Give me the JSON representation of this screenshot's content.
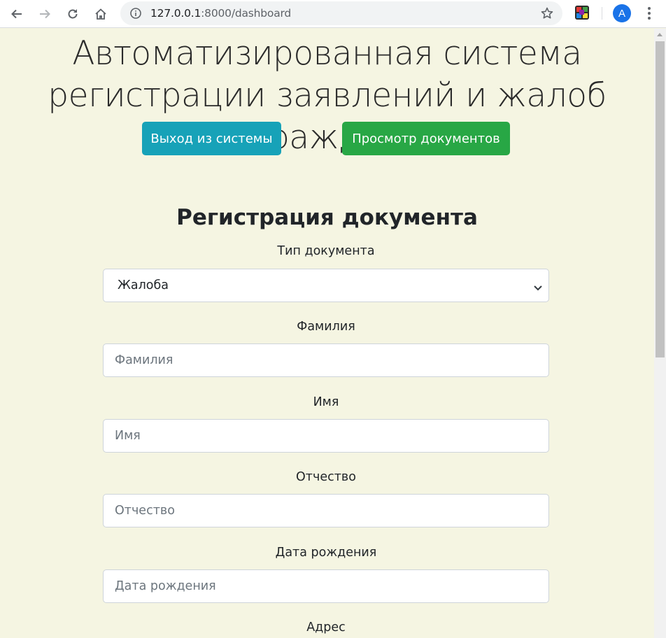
{
  "browser": {
    "url_host": "127.0.0.1",
    "url_rest": ":8000/dashboard",
    "profile_initial": "A",
    "accent_color": "#1a73e8"
  },
  "header": {
    "title_line1": "Автоматизированная система",
    "title_line2": "регистрации заявлений и жалоб граждан",
    "logout_label": "Выход из системы",
    "docs_label": "Просмотр документов",
    "logout_color": "#17a2b8",
    "docs_color": "#28a745"
  },
  "form": {
    "title": "Регистрация документа",
    "doc_type_label": "Тип документа",
    "doc_type_value": "Жалоба",
    "lastname_label": "Фамилия",
    "lastname_placeholder": "Фамилия",
    "firstname_label": "Имя",
    "firstname_placeholder": "Имя",
    "patronymic_label": "Отчество",
    "patronymic_placeholder": "Отчество",
    "birthdate_label": "Дата рождения",
    "birthdate_placeholder": "Дата рождения",
    "address_label": "Адрес"
  },
  "icons": [
    "back-icon",
    "forward-icon",
    "reload-icon",
    "home-icon",
    "info-icon",
    "star-icon",
    "extension-icon",
    "menu-icon",
    "chevron-down-icon"
  ]
}
